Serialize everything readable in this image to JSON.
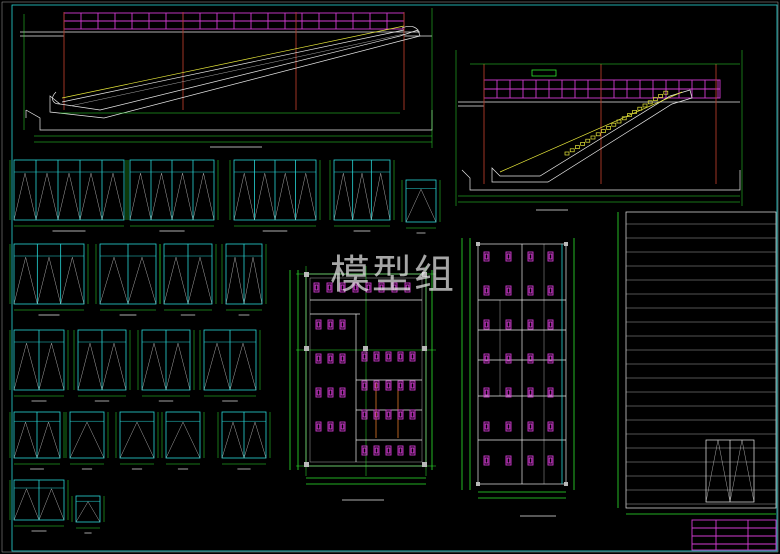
{
  "watermark": {
    "text": "模型组"
  },
  "colors": {
    "background": "#000000",
    "frame": "#27d6d6",
    "dimension": "#2ee82e",
    "line": "#e8e8e8",
    "fixture": "#d23bd2",
    "escalator_track": "#e8e83a"
  }
}
